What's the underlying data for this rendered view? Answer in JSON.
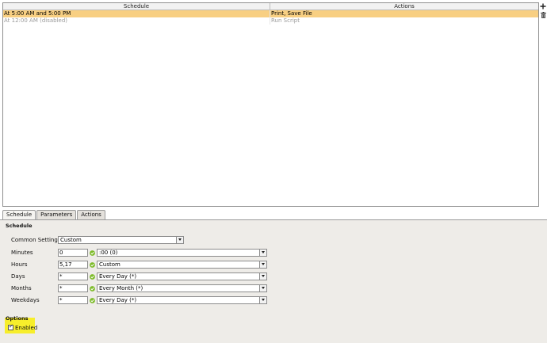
{
  "table": {
    "columns": [
      "Schedule",
      "Actions"
    ],
    "rows": [
      {
        "schedule": "At 5:00 AM and 5:00 PM",
        "actions": "Print, Save File",
        "state": "selected"
      },
      {
        "schedule": "At 12:00 AM (disabled)",
        "actions": "Run Script",
        "state": "disabled"
      }
    ]
  },
  "toolbar": {
    "add_icon": "plus-icon",
    "delete_icon": "trash-icon"
  },
  "tabs": [
    {
      "label": "Schedule",
      "active": true
    },
    {
      "label": "Parameters",
      "active": false
    },
    {
      "label": "Actions",
      "active": false
    }
  ],
  "schedule_section": {
    "title": "Schedule",
    "common_settings": {
      "label": "Common Settings",
      "value": "Custom"
    },
    "fields": [
      {
        "label": "Minutes",
        "input": "0",
        "select": ":00 (0)"
      },
      {
        "label": "Hours",
        "input": "5,17",
        "select": "Custom"
      },
      {
        "label": "Days",
        "input": "*",
        "select": "Every Day (*)"
      },
      {
        "label": "Months",
        "input": "*",
        "select": "Every Month (*)"
      },
      {
        "label": "Weekdays",
        "input": "*",
        "select": "Every Day (*)"
      }
    ]
  },
  "options_section": {
    "title": "Options",
    "enabled": {
      "label": "Enabled",
      "checked": true
    }
  },
  "colors": {
    "selected_row": "#f8cf82",
    "highlight": "#f7ee2b",
    "valid_icon": "#7dbb2a",
    "panel_bg": "#eeece8"
  }
}
